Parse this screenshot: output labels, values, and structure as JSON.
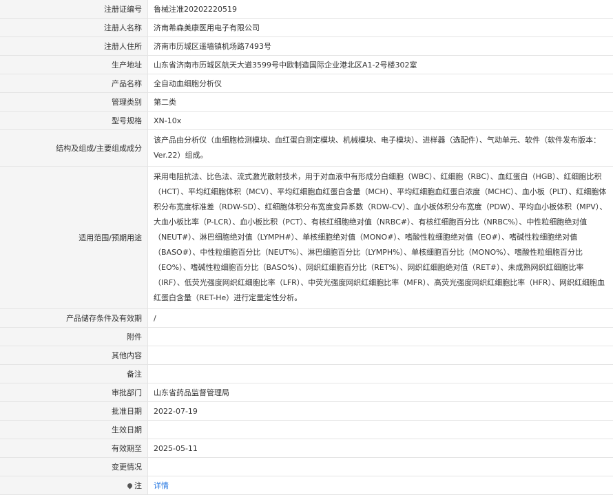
{
  "rows": [
    {
      "label": "注册证编号",
      "value": "鲁械注准20202220519"
    },
    {
      "label": "注册人名称",
      "value": "济南希森美康医用电子有限公司"
    },
    {
      "label": "注册人住所",
      "value": "济南市历城区遥墙镇机场路7493号"
    },
    {
      "label": "生产地址",
      "value": "山东省济南市历城区航天大道3599号中欧制造国际企业港北区A1-2号楼302室"
    },
    {
      "label": "产品名称",
      "value": "全自动血细胞分析仪"
    },
    {
      "label": "管理类别",
      "value": "第二类"
    },
    {
      "label": "型号规格",
      "value": "XN-10x"
    },
    {
      "label": "结构及组成/主要组成成分",
      "value": "该产品由分析仪（血细胞检测模块、血红蛋白测定模块、机械模块、电子模块）、进样器（选配件）、气动单元、软件（软件发布版本：Ver.22）组成。"
    },
    {
      "label": "适用范围/预期用途",
      "value": "采用电阻抗法、比色法、流式激光散射技术，用于对血液中有形成分白细胞（WBC）、红细胞（RBC）、血红蛋白（HGB）、红细胞比积（HCT）、平均红细胞体积（MCV）、平均红细胞血红蛋白含量（MCH）、平均红细胞血红蛋白浓度（MCHC）、血小板（PLT）、红细胞体积分布宽度标准差（RDW-SD）、红细胞体积分布宽度变异系数（RDW-CV）、血小板体积分布宽度（PDW）、平均血小板体积（MPV）、大血小板比率（P-LCR）、血小板比积（PCT）、有核红细胞绝对值（NRBC#）、有核红细胞百分比（NRBC%）、中性粒细胞绝对值（NEUT#）、淋巴细胞绝对值（LYMPH#）、单核细胞绝对值（MONO#）、嗜酸性粒细胞绝对值（EO#）、嗜碱性粒细胞绝对值（BASO#）、中性粒细胞百分比（NEUT%）、淋巴细胞百分比（LYMPH%）、单核细胞百分比（MONO%）、嗜酸性粒细胞百分比（EO%）、嗜碱性粒细胞百分比（BASO%）、网织红细胞百分比（RET%）、网织红细胞绝对值（RET#）、未成熟网织红细胞比率（IRF）、低荧光强度网织红细胞比率（LFR）、中荧光强度网织红细胞比率（MFR）、高荧光强度网织红细胞比率（HFR）、网织红细胞血红蛋白含量（RET-He）进行定量定性分析。"
    },
    {
      "label": "产品储存条件及有效期",
      "value": "/"
    },
    {
      "label": "附件",
      "value": ""
    },
    {
      "label": "其他内容",
      "value": ""
    },
    {
      "label": "备注",
      "value": ""
    },
    {
      "label": "审批部门",
      "value": "山东省药品监督管理局"
    },
    {
      "label": "批准日期",
      "value": "2022-07-19"
    },
    {
      "label": "生效日期",
      "value": ""
    },
    {
      "label": "有效期至",
      "value": "2025-05-11"
    },
    {
      "label": "变更情况",
      "value": ""
    }
  ],
  "note": {
    "label": "注",
    "icon": "pin-icon",
    "link_text": "详情"
  }
}
